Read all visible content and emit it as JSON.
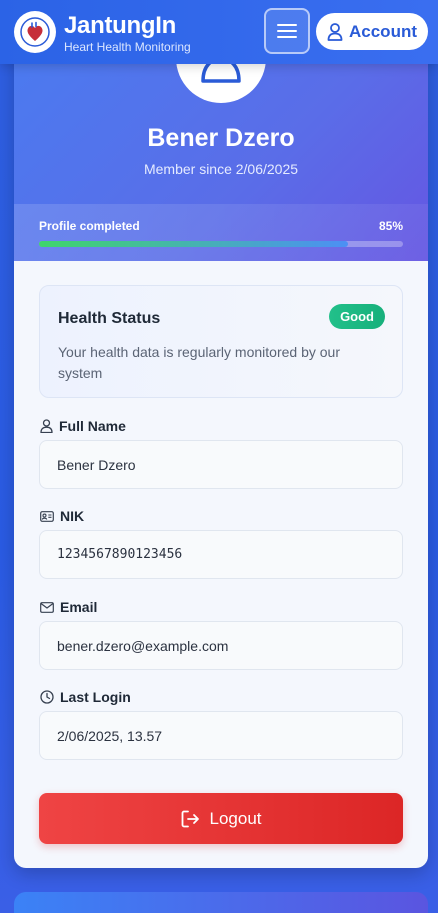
{
  "header": {
    "brand_name": "JantungIn",
    "brand_sub": "Heart Health Monitoring",
    "account_label": "Account"
  },
  "profile": {
    "name": "Bener Dzero",
    "member_since": "Member since 2/06/2025",
    "progress_label": "Profile completed",
    "progress_value": "85%",
    "progress_fraction": 0.85
  },
  "health": {
    "title": "Health Status",
    "badge": "Good",
    "description": "Your health data is regularly monitored by our system"
  },
  "fields": {
    "full_name_label": "Full Name",
    "full_name_value": "Bener Dzero",
    "nik_label": "NIK",
    "nik_value": "1234567890123456",
    "email_label": "Email",
    "email_value": "bener.dzero@example.com",
    "last_login_label": "Last Login",
    "last_login_value": "2/06/2025, 13.57"
  },
  "actions": {
    "logout_label": "Logout"
  },
  "colors": {
    "primary": "#2b63e6",
    "good": "#22c08a",
    "danger": "#ef4444"
  }
}
